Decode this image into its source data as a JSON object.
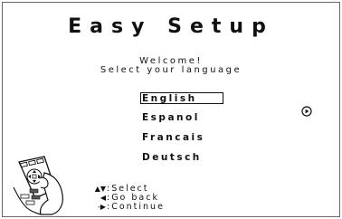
{
  "screen": {
    "title": "Easy Setup",
    "welcome": "Welcome!",
    "subtitle": "Select your language"
  },
  "languages": {
    "items": [
      {
        "label": "English",
        "selected": true
      },
      {
        "label": "Espanol",
        "selected": false
      },
      {
        "label": "Francais",
        "selected": false
      },
      {
        "label": "Deutsch",
        "selected": false
      }
    ]
  },
  "icons": {
    "next": "play-circle-icon",
    "remote": "remote-control-hand-icon"
  },
  "instructions": [
    {
      "keys": "▲▼",
      "text": ":Select"
    },
    {
      "keys": "◀",
      "text": ":Go back"
    },
    {
      "keys": "-▶",
      "text": ":Continue"
    }
  ]
}
